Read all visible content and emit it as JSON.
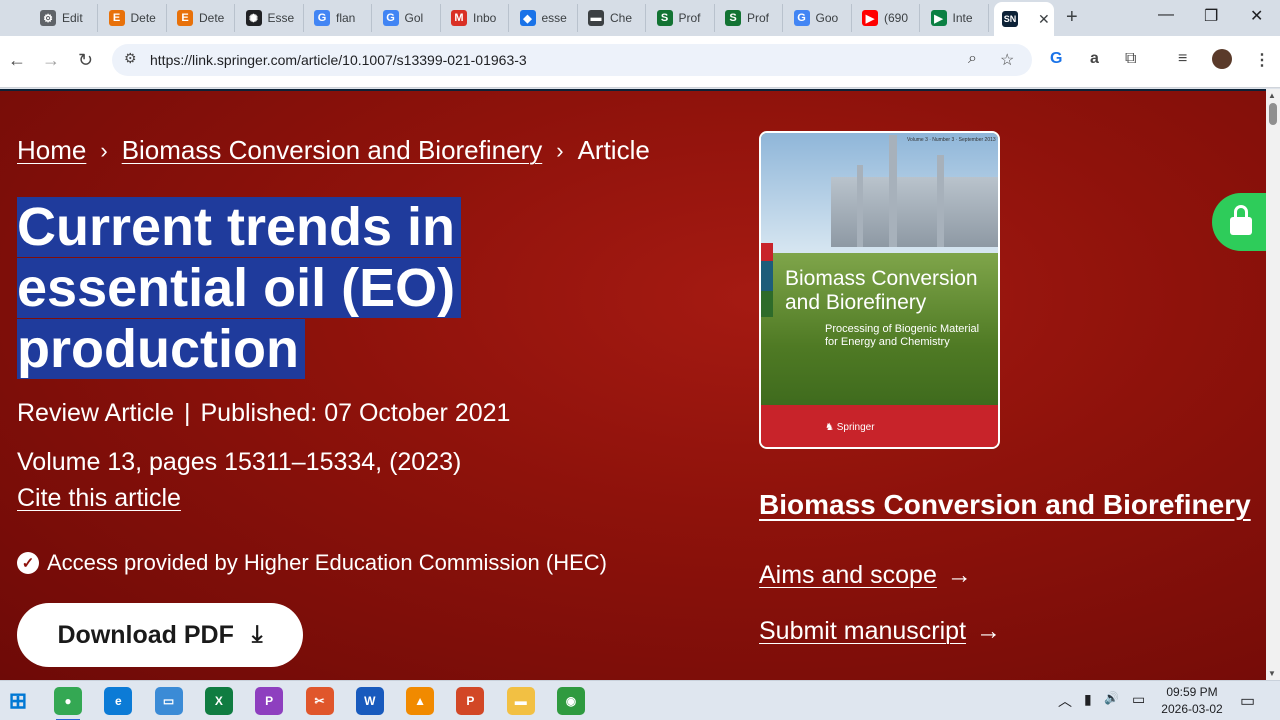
{
  "browser": {
    "tabs": [
      {
        "title": "Edit",
        "icon": "settings-icon",
        "color": "#5f6368",
        "glyph": "⚙"
      },
      {
        "title": "Dete",
        "icon": "e-icon",
        "color": "#e8710a",
        "glyph": "E"
      },
      {
        "title": "Dete",
        "icon": "e-icon",
        "color": "#e8710a",
        "glyph": "E"
      },
      {
        "title": "Esse",
        "icon": "openai-icon",
        "color": "#202124",
        "glyph": "✺"
      },
      {
        "title": "flan",
        "icon": "google-icon",
        "color": "#4285f4",
        "glyph": "G"
      },
      {
        "title": "Gol",
        "icon": "google-icon",
        "color": "#4285f4",
        "glyph": "G"
      },
      {
        "title": "Inbo",
        "icon": "gmail-icon",
        "color": "#d93025",
        "glyph": "M"
      },
      {
        "title": "esse",
        "icon": "diamond-icon",
        "color": "#1a73e8",
        "glyph": "◆"
      },
      {
        "title": "Che",
        "icon": "car-icon",
        "color": "#3c4043",
        "glyph": "▬"
      },
      {
        "title": "Prof",
        "icon": "scispace-icon",
        "color": "#137333",
        "glyph": "S"
      },
      {
        "title": "Prof",
        "icon": "scispace-icon",
        "color": "#137333",
        "glyph": "S"
      },
      {
        "title": "Goo",
        "icon": "google-icon",
        "color": "#4285f4",
        "glyph": "G"
      },
      {
        "title": "(690",
        "icon": "youtube-icon",
        "color": "#ff0000",
        "glyph": "▶"
      },
      {
        "title": "Inte",
        "icon": "play-icon",
        "color": "#0b8043",
        "glyph": "▶"
      }
    ],
    "active_tab": {
      "icon": "springer-nature-icon",
      "glyph": "SN",
      "close": "✕"
    },
    "new_tab": "+",
    "window_controls": {
      "minimize": "—",
      "restore": "❐",
      "close": "✕"
    },
    "url": "https://link.springer.com/article/10.1007/s13399-021-01963-3",
    "nav": {
      "back": "←",
      "forward": "→",
      "reload": "↻",
      "tune": "⚙"
    },
    "omnibox_icons": {
      "zoom": "⌕",
      "star": "☆"
    },
    "toolbar_icons": {
      "translate": "G",
      "extension1": "a",
      "extensions": "⧉",
      "media": "≡",
      "menu": "⋮"
    }
  },
  "breadcrumb": {
    "home": "Home",
    "journal": "Biomass Conversion and Biorefinery",
    "current": "Article",
    "separator": "›"
  },
  "article": {
    "title": "Current trends in essential oil (EO) production",
    "type": "Review Article",
    "published": "Published: 07 October 2021",
    "volume": "Volume 13, pages 15311–15334, (2023)",
    "cite": "Cite this article",
    "access": "Access provided by Higher Education Commission (HEC)",
    "download": "Download PDF"
  },
  "journal": {
    "cover_topline": "Volume 3 · Number 3 · September 2013",
    "cover_title_1": "Biomass Conversion",
    "cover_title_2": "and Biorefinery",
    "cover_subtitle_1": "Processing of Biogenic Material",
    "cover_subtitle_2": "for Energy and Chemistry",
    "cover_publisher": "Springer",
    "name": "Biomass Conversion and Biorefinery",
    "aims": "Aims and scope",
    "submit": "Submit manuscript",
    "arrow": "→"
  },
  "colors": {
    "page_bg": "#8e120b",
    "title_highlight": "#1f3b9c",
    "unlock_green": "#2ecc5a",
    "cover_red": "#c8232a"
  },
  "taskbar": {
    "apps": [
      {
        "name": "windows-start-icon",
        "color": "#0078d4",
        "label": "⊞"
      },
      {
        "name": "chrome-icon",
        "color": "#34a853",
        "label": "●"
      },
      {
        "name": "edge-icon",
        "color": "#0c7bd6",
        "label": "e"
      },
      {
        "name": "computer-icon",
        "color": "#3b8bd6",
        "label": "▭"
      },
      {
        "name": "excel-icon",
        "color": "#107c41",
        "label": "X"
      },
      {
        "name": "pdf-editor-icon",
        "color": "#8e3fbf",
        "label": "P"
      },
      {
        "name": "snipping-tool-icon",
        "color": "#e0562b",
        "label": "✂"
      },
      {
        "name": "word-icon",
        "color": "#185abd",
        "label": "W"
      },
      {
        "name": "vlc-icon",
        "color": "#f18a00",
        "label": "▲"
      },
      {
        "name": "powerpoint-icon",
        "color": "#d24726",
        "label": "P"
      },
      {
        "name": "file-explorer-icon",
        "color": "#f2c043",
        "label": "▬"
      },
      {
        "name": "network-globe-icon",
        "color": "#2f9a3f",
        "label": "◉"
      }
    ],
    "tray": {
      "chevron": "︿",
      "battery": "▮",
      "volume": "🔊",
      "network": "▭",
      "notification": "▭"
    },
    "time": "09:59 PM",
    "date": "2026-03-02"
  }
}
